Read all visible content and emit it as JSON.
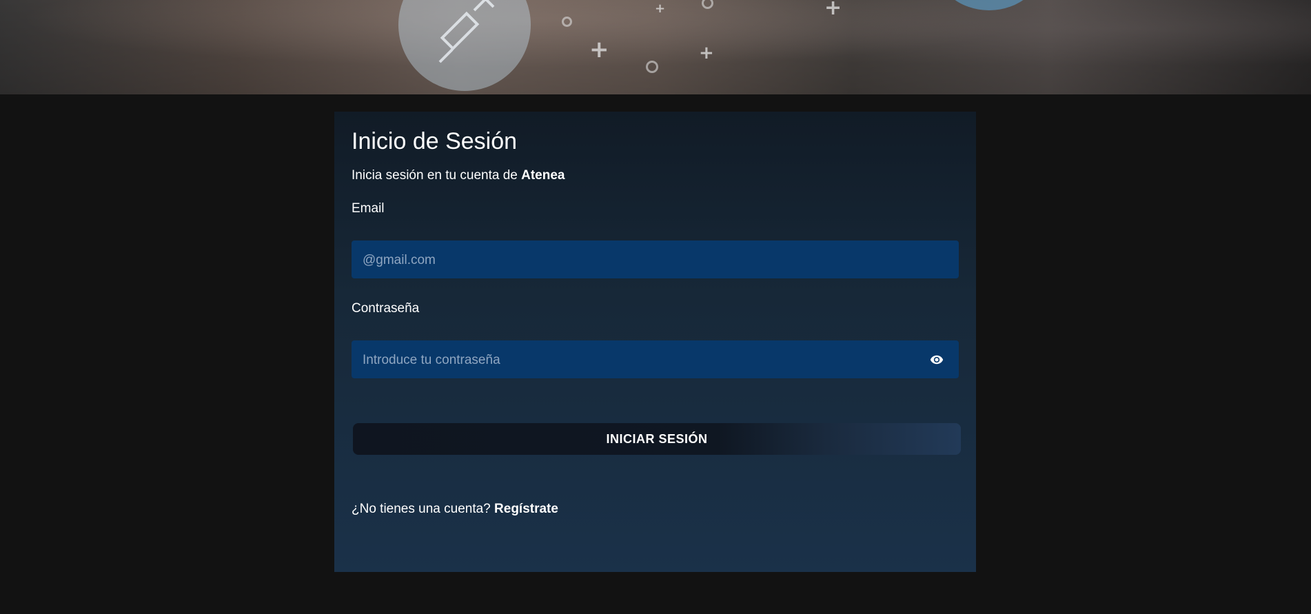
{
  "login": {
    "title": "Inicio de Sesión",
    "subtitle_prefix": "Inicia sesión en tu cuenta de ",
    "brand": "Atenea",
    "email_label": "Email",
    "email_placeholder": "@gmail.com",
    "email_value": "",
    "password_label": "Contraseña",
    "password_placeholder": "Introduce tu contraseña",
    "password_value": "",
    "submit_label": "INICIAR SESIÓN",
    "register_prompt": "¿No tienes una cuenta? ",
    "register_link": "Regístrate"
  },
  "icons": {
    "password_toggle": "eye-icon",
    "hero_syringe": "syringe-icon"
  },
  "colors": {
    "page_background": "#121212",
    "input_background": "#08386a",
    "text": "#ffffff",
    "placeholder": "#8fa6c1"
  }
}
